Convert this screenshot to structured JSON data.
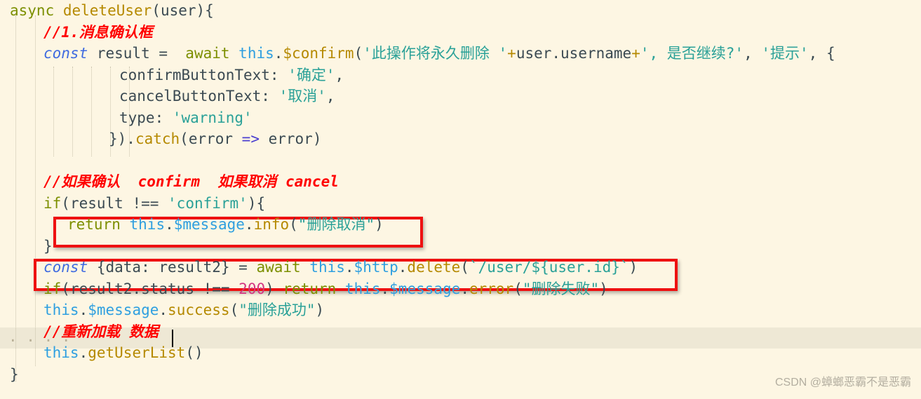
{
  "editor": {
    "background_color": "#fdf6e3",
    "highlight_color": "#eee8d5",
    "annotation_color": "#ee1111",
    "comment_color": "#ff0000",
    "caret_color": "#000000"
  },
  "watermark": {
    "text": "CSDN @蟑螂恶霸不是恶霸"
  },
  "code": {
    "line1": {
      "kw_async": "async ",
      "fn_name": "deleteUser",
      "punct_open": "(",
      "param": "user",
      "punct_close": "){"
    },
    "line2": {
      "comment": "//1.消息确认框"
    },
    "line3": {
      "kw_const": "const",
      "var_result": " result =  ",
      "kw_await": "await",
      "space": " ",
      "this": "this",
      "dot": ".",
      "method": "$confirm",
      "paren_open": "(",
      "str1": "'此操作将永久删除 '",
      "plus1": "+",
      "expr": "user.username",
      "plus2": "+",
      "str2": "', 是否继续?'",
      "comma1": ", ",
      "str3": "'提示'",
      "comma2": ", {"
    },
    "line4": {
      "key": "confirmButtonText: ",
      "value": "'确定'",
      "comma": ","
    },
    "line5": {
      "key": "cancelButtonText: ",
      "value": "'取消'",
      "comma": ","
    },
    "line6": {
      "key": "type: ",
      "value": "'warning'"
    },
    "line7": {
      "close": "}).",
      "method": "catch",
      "paren_open": "(",
      "param": "error ",
      "arrow": "=>",
      "body": " error)"
    },
    "line8": {
      "blank": ""
    },
    "line9": {
      "comment": "//如果确认  confirm  如果取消 cancel"
    },
    "line10": {
      "kw_if": "if",
      "paren_open": "(",
      "expr": "result !== ",
      "str": "'confirm'",
      "close": "){"
    },
    "line11": {
      "kw_return": "return",
      "space": " ",
      "this": "this",
      "dot1": ".",
      "prop": "$message",
      "dot2": ".",
      "method": "info",
      "paren_open": "(",
      "str": "\"删除取消\"",
      "paren_close": ")"
    },
    "line12": {
      "close": "}"
    },
    "line13": {
      "kw_const": "const",
      "destructure": " {data: result2} = ",
      "kw_await": "await",
      "space": " ",
      "this": "this",
      "dot1": ".",
      "prop": "$http",
      "dot2": ".",
      "method": "delete",
      "paren_open": "(",
      "template": "`/user/${user.id}`",
      "paren_close": ")"
    },
    "line14": {
      "kw_if": "if",
      "paren_open": "(",
      "expr": "result2.status !== ",
      "num": "200",
      "paren_close": ") ",
      "kw_return": "return",
      "space": " ",
      "this": "this",
      "dot1": ".",
      "prop": "$message",
      "dot2": ".",
      "method": "error",
      "paren_open2": "(",
      "str": "\"删除失败\"",
      "paren_close2": ")"
    },
    "line15": {
      "this": "this",
      "dot1": ".",
      "prop": "$message",
      "dot2": ".",
      "method": "success",
      "paren_open": "(",
      "str": "\"删除成功\"",
      "paren_close": ")"
    },
    "line16": {
      "comment": "//重新加载 数据"
    },
    "line17": {
      "this": "this",
      "dot": ".",
      "method": "getUserList",
      "parens": "()"
    },
    "line18": {
      "close": "}"
    }
  },
  "annotations": [
    {
      "label": "info-message-box",
      "target": "return this.$message.info(\"删除取消\")"
    },
    {
      "label": "http-delete-box",
      "target": "const {data: result2} = await this.$http.delete(`/user/${user.id}`)"
    }
  ]
}
